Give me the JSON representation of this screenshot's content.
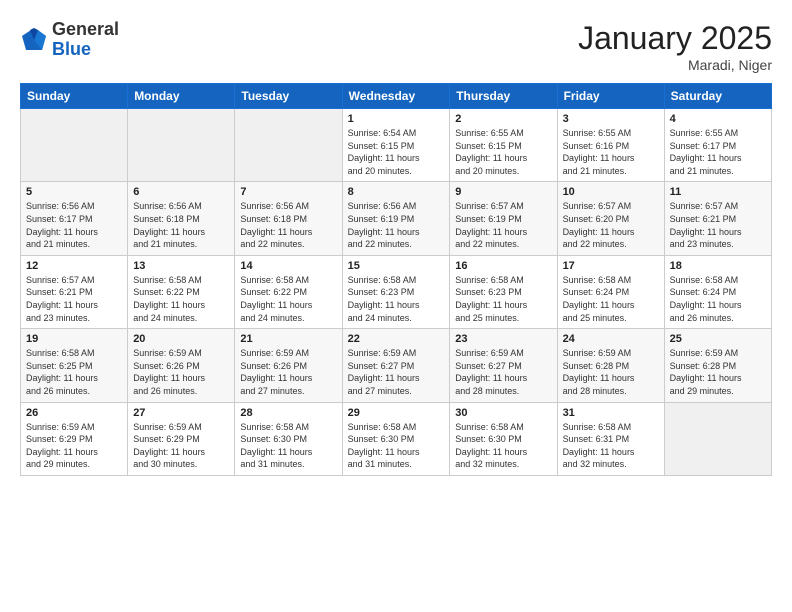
{
  "header": {
    "logo_general": "General",
    "logo_blue": "Blue",
    "month": "January 2025",
    "location": "Maradi, Niger"
  },
  "weekdays": [
    "Sunday",
    "Monday",
    "Tuesday",
    "Wednesday",
    "Thursday",
    "Friday",
    "Saturday"
  ],
  "weeks": [
    [
      {
        "day": "",
        "info": ""
      },
      {
        "day": "",
        "info": ""
      },
      {
        "day": "",
        "info": ""
      },
      {
        "day": "1",
        "info": "Sunrise: 6:54 AM\nSunset: 6:15 PM\nDaylight: 11 hours\nand 20 minutes."
      },
      {
        "day": "2",
        "info": "Sunrise: 6:55 AM\nSunset: 6:15 PM\nDaylight: 11 hours\nand 20 minutes."
      },
      {
        "day": "3",
        "info": "Sunrise: 6:55 AM\nSunset: 6:16 PM\nDaylight: 11 hours\nand 21 minutes."
      },
      {
        "day": "4",
        "info": "Sunrise: 6:55 AM\nSunset: 6:17 PM\nDaylight: 11 hours\nand 21 minutes."
      }
    ],
    [
      {
        "day": "5",
        "info": "Sunrise: 6:56 AM\nSunset: 6:17 PM\nDaylight: 11 hours\nand 21 minutes."
      },
      {
        "day": "6",
        "info": "Sunrise: 6:56 AM\nSunset: 6:18 PM\nDaylight: 11 hours\nand 21 minutes."
      },
      {
        "day": "7",
        "info": "Sunrise: 6:56 AM\nSunset: 6:18 PM\nDaylight: 11 hours\nand 22 minutes."
      },
      {
        "day": "8",
        "info": "Sunrise: 6:56 AM\nSunset: 6:19 PM\nDaylight: 11 hours\nand 22 minutes."
      },
      {
        "day": "9",
        "info": "Sunrise: 6:57 AM\nSunset: 6:19 PM\nDaylight: 11 hours\nand 22 minutes."
      },
      {
        "day": "10",
        "info": "Sunrise: 6:57 AM\nSunset: 6:20 PM\nDaylight: 11 hours\nand 22 minutes."
      },
      {
        "day": "11",
        "info": "Sunrise: 6:57 AM\nSunset: 6:21 PM\nDaylight: 11 hours\nand 23 minutes."
      }
    ],
    [
      {
        "day": "12",
        "info": "Sunrise: 6:57 AM\nSunset: 6:21 PM\nDaylight: 11 hours\nand 23 minutes."
      },
      {
        "day": "13",
        "info": "Sunrise: 6:58 AM\nSunset: 6:22 PM\nDaylight: 11 hours\nand 24 minutes."
      },
      {
        "day": "14",
        "info": "Sunrise: 6:58 AM\nSunset: 6:22 PM\nDaylight: 11 hours\nand 24 minutes."
      },
      {
        "day": "15",
        "info": "Sunrise: 6:58 AM\nSunset: 6:23 PM\nDaylight: 11 hours\nand 24 minutes."
      },
      {
        "day": "16",
        "info": "Sunrise: 6:58 AM\nSunset: 6:23 PM\nDaylight: 11 hours\nand 25 minutes."
      },
      {
        "day": "17",
        "info": "Sunrise: 6:58 AM\nSunset: 6:24 PM\nDaylight: 11 hours\nand 25 minutes."
      },
      {
        "day": "18",
        "info": "Sunrise: 6:58 AM\nSunset: 6:24 PM\nDaylight: 11 hours\nand 26 minutes."
      }
    ],
    [
      {
        "day": "19",
        "info": "Sunrise: 6:58 AM\nSunset: 6:25 PM\nDaylight: 11 hours\nand 26 minutes."
      },
      {
        "day": "20",
        "info": "Sunrise: 6:59 AM\nSunset: 6:26 PM\nDaylight: 11 hours\nand 26 minutes."
      },
      {
        "day": "21",
        "info": "Sunrise: 6:59 AM\nSunset: 6:26 PM\nDaylight: 11 hours\nand 27 minutes."
      },
      {
        "day": "22",
        "info": "Sunrise: 6:59 AM\nSunset: 6:27 PM\nDaylight: 11 hours\nand 27 minutes."
      },
      {
        "day": "23",
        "info": "Sunrise: 6:59 AM\nSunset: 6:27 PM\nDaylight: 11 hours\nand 28 minutes."
      },
      {
        "day": "24",
        "info": "Sunrise: 6:59 AM\nSunset: 6:28 PM\nDaylight: 11 hours\nand 28 minutes."
      },
      {
        "day": "25",
        "info": "Sunrise: 6:59 AM\nSunset: 6:28 PM\nDaylight: 11 hours\nand 29 minutes."
      }
    ],
    [
      {
        "day": "26",
        "info": "Sunrise: 6:59 AM\nSunset: 6:29 PM\nDaylight: 11 hours\nand 29 minutes."
      },
      {
        "day": "27",
        "info": "Sunrise: 6:59 AM\nSunset: 6:29 PM\nDaylight: 11 hours\nand 30 minutes."
      },
      {
        "day": "28",
        "info": "Sunrise: 6:58 AM\nSunset: 6:30 PM\nDaylight: 11 hours\nand 31 minutes."
      },
      {
        "day": "29",
        "info": "Sunrise: 6:58 AM\nSunset: 6:30 PM\nDaylight: 11 hours\nand 31 minutes."
      },
      {
        "day": "30",
        "info": "Sunrise: 6:58 AM\nSunset: 6:30 PM\nDaylight: 11 hours\nand 32 minutes."
      },
      {
        "day": "31",
        "info": "Sunrise: 6:58 AM\nSunset: 6:31 PM\nDaylight: 11 hours\nand 32 minutes."
      },
      {
        "day": "",
        "info": ""
      }
    ]
  ]
}
